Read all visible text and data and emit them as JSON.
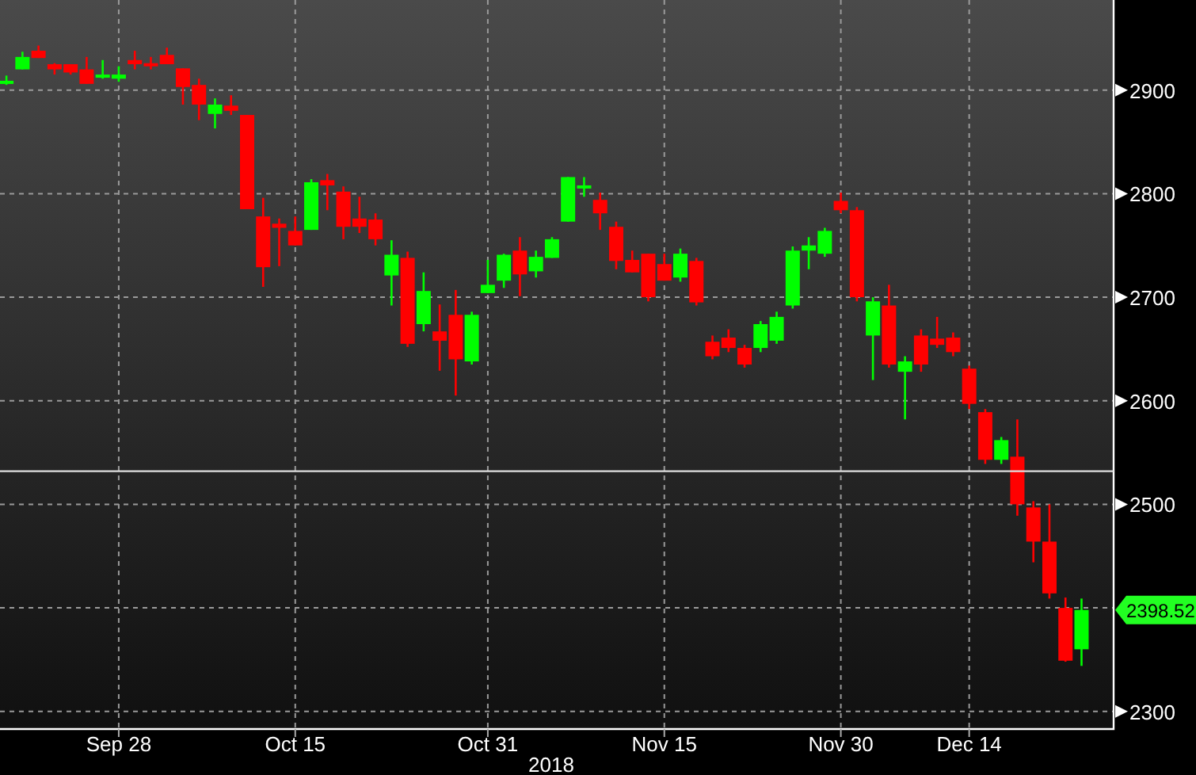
{
  "chart_data": {
    "type": "candlestick",
    "xlabel": "2018",
    "categories": [
      null,
      null,
      null,
      null,
      null,
      null,
      null,
      "Sep 28",
      null,
      null,
      null,
      null,
      null,
      null,
      null,
      null,
      null,
      null,
      "Oct 15",
      null,
      null,
      null,
      null,
      null,
      null,
      null,
      null,
      null,
      null,
      null,
      "Oct 31",
      null,
      null,
      null,
      null,
      null,
      null,
      null,
      null,
      null,
      null,
      "Nov 15",
      null,
      null,
      null,
      null,
      null,
      null,
      null,
      null,
      null,
      null,
      "Nov 30",
      null,
      null,
      null,
      null,
      null,
      null,
      null,
      "Dec 14",
      null,
      null,
      null,
      null,
      null,
      null,
      null
    ],
    "ohlc": [
      [
        2906,
        2914,
        2905,
        2909
      ],
      [
        2920,
        2937,
        2920,
        2932
      ],
      [
        2938,
        2943,
        2931,
        2931
      ],
      [
        2925,
        2926,
        2915,
        2920
      ],
      [
        2925,
        2925,
        2915,
        2917
      ],
      [
        2920,
        2932,
        2906,
        2906
      ],
      [
        2912,
        2929,
        2911,
        2915
      ],
      [
        2911,
        2923,
        2908,
        2915
      ],
      [
        2929,
        2938,
        2920,
        2925
      ],
      [
        2926,
        2932,
        2920,
        2923
      ],
      [
        2934,
        2941,
        2925,
        2925
      ],
      [
        2921,
        2921,
        2886,
        2903
      ],
      [
        2905,
        2911,
        2871,
        2886
      ],
      [
        2877,
        2892,
        2863,
        2886
      ],
      [
        2885,
        2895,
        2876,
        2880
      ],
      [
        2876,
        2876,
        2785,
        2785
      ],
      [
        2778,
        2796,
        2710,
        2729
      ],
      [
        2771,
        2776,
        2730,
        2767
      ],
      [
        2764,
        2778,
        2750,
        2750
      ],
      [
        2765,
        2814,
        2765,
        2811
      ],
      [
        2813,
        2819,
        2784,
        2808
      ],
      [
        2802,
        2807,
        2756,
        2768
      ],
      [
        2776,
        2797,
        2762,
        2768
      ],
      [
        2775,
        2781,
        2750,
        2756
      ],
      [
        2721,
        2755,
        2692,
        2741
      ],
      [
        2738,
        2744,
        2652,
        2655
      ],
      [
        2674,
        2724,
        2667,
        2706
      ],
      [
        2667,
        2693,
        2629,
        2658
      ],
      [
        2683,
        2707,
        2605,
        2640
      ],
      [
        2638,
        2686,
        2635,
        2683
      ],
      [
        2704,
        2736,
        2704,
        2712
      ],
      [
        2716,
        2742,
        2709,
        2741
      ],
      [
        2745,
        2758,
        2701,
        2722
      ],
      [
        2725,
        2745,
        2719,
        2739
      ],
      [
        2738,
        2758,
        2738,
        2756
      ],
      [
        2773,
        2816,
        2773,
        2816
      ],
      [
        2805,
        2816,
        2797,
        2808
      ],
      [
        2794,
        2801,
        2765,
        2781
      ],
      [
        2768,
        2773,
        2727,
        2735
      ],
      [
        2736,
        2745,
        2724,
        2724
      ],
      [
        2742,
        2742,
        2696,
        2700
      ],
      [
        2732,
        2742,
        2716,
        2716
      ],
      [
        2719,
        2747,
        2715,
        2742
      ],
      [
        2735,
        2738,
        2692,
        2695
      ],
      [
        2657,
        2663,
        2640,
        2643
      ],
      [
        2661,
        2669,
        2647,
        2651
      ],
      [
        2651,
        2654,
        2632,
        2635
      ],
      [
        2651,
        2677,
        2647,
        2674
      ],
      [
        2658,
        2686,
        2655,
        2681
      ],
      [
        2692,
        2749,
        2689,
        2745
      ],
      [
        2745,
        2758,
        2727,
        2750
      ],
      [
        2742,
        2767,
        2739,
        2764
      ],
      [
        2793,
        2801,
        2781,
        2784
      ],
      [
        2784,
        2787,
        2696,
        2700
      ],
      [
        2663,
        2700,
        2620,
        2696
      ],
      [
        2692,
        2712,
        2632,
        2635
      ],
      [
        2628,
        2643,
        2582,
        2638
      ],
      [
        2663,
        2669,
        2628,
        2635
      ],
      [
        2660,
        2681,
        2651,
        2654
      ],
      [
        2661,
        2666,
        2643,
        2647
      ],
      [
        2631,
        2634,
        2592,
        2597
      ],
      [
        2589,
        2592,
        2539,
        2543
      ],
      [
        2543,
        2565,
        2539,
        2562
      ],
      [
        2546,
        2582,
        2489,
        2500
      ],
      [
        2497,
        2503,
        2444,
        2464
      ],
      [
        2464,
        2500,
        2409,
        2414
      ],
      [
        2400,
        2410,
        2348,
        2349
      ],
      [
        2360,
        2409,
        2344,
        2398
      ]
    ],
    "ylim": [
      2283,
      2987
    ],
    "yticks": [
      2300,
      2500,
      2600,
      2700,
      2800,
      2900
    ],
    "grid": true,
    "ref_lines": [
      {
        "axis": "y",
        "value": 2532
      }
    ],
    "annotations": [
      {
        "text": "2398.52"
      }
    ]
  }
}
